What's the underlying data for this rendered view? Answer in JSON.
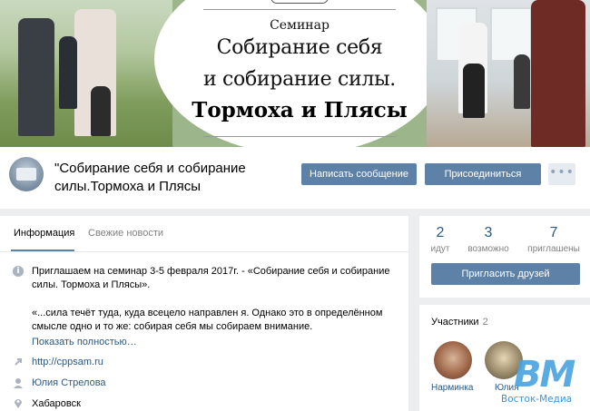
{
  "cover": {
    "seminar_label": "Семинар",
    "title_line1": "Собирание себя",
    "title_line2": "и собирание силы.",
    "title_line3": "Тормоха и Плясы"
  },
  "header": {
    "group_title": "\"Собирание себя и собирание силы.Тормоха и Плясы",
    "message_button": "Написать сообщение",
    "join_button": "Присоединиться",
    "more_button": "•••"
  },
  "info": {
    "tabs": [
      {
        "label": "Информация"
      },
      {
        "label": "Свежие новости"
      }
    ],
    "info_icon": "i",
    "description": "Приглашаем на семинар 3-5 февраля 2017г. - «Собирание себя и собирание силы. Тормоха и Плясы».",
    "quote": "«...сила течёт туда, куда всецело направлен я. Однако это в определённом смысле одно и то же: собирая себя мы собираем внимание.",
    "show_more": "Показать полностью…",
    "site": "http://cppsam.ru",
    "person": "Юлия Стрелова",
    "city": "Хабаровск",
    "icons": [
      "info-icon",
      "link-icon",
      "user-icon",
      "location-icon"
    ]
  },
  "stats": {
    "items": [
      {
        "value": "2",
        "label": "идут"
      },
      {
        "value": "3",
        "label": "возможно"
      },
      {
        "value": "7",
        "label": "приглашены"
      }
    ],
    "invite_button": "Пригласить друзей"
  },
  "members": {
    "title": "Участники",
    "count": "2",
    "list": [
      {
        "name": "Нарминка"
      },
      {
        "name": "Юлия"
      }
    ]
  },
  "watermark": {
    "logo": "ВМ",
    "text": "Восток-Медиа"
  },
  "colors": {
    "accent": "#5e81a8",
    "link": "#2a5885",
    "background": "#edeef0"
  }
}
